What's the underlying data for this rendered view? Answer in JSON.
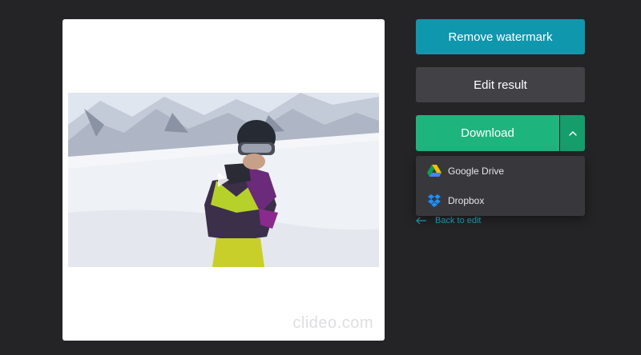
{
  "preview": {
    "watermark_text": "clideo.com"
  },
  "actions": {
    "remove_watermark_label": "Remove watermark",
    "edit_result_label": "Edit result",
    "download_label": "Download"
  },
  "download_menu": {
    "items": [
      {
        "label": "Google Drive",
        "icon": "google-drive-icon"
      },
      {
        "label": "Dropbox",
        "icon": "dropbox-icon"
      }
    ]
  },
  "back": {
    "label": "Back to edit",
    "icon": "arrow-left-icon"
  },
  "colors": {
    "background": "#242426",
    "remove_watermark": "#0f97ad",
    "edit_result": "#424246",
    "download": "#1db57d",
    "download_toggle": "#159e6c",
    "menu": "#38383c",
    "link": "#1a8fa6"
  }
}
